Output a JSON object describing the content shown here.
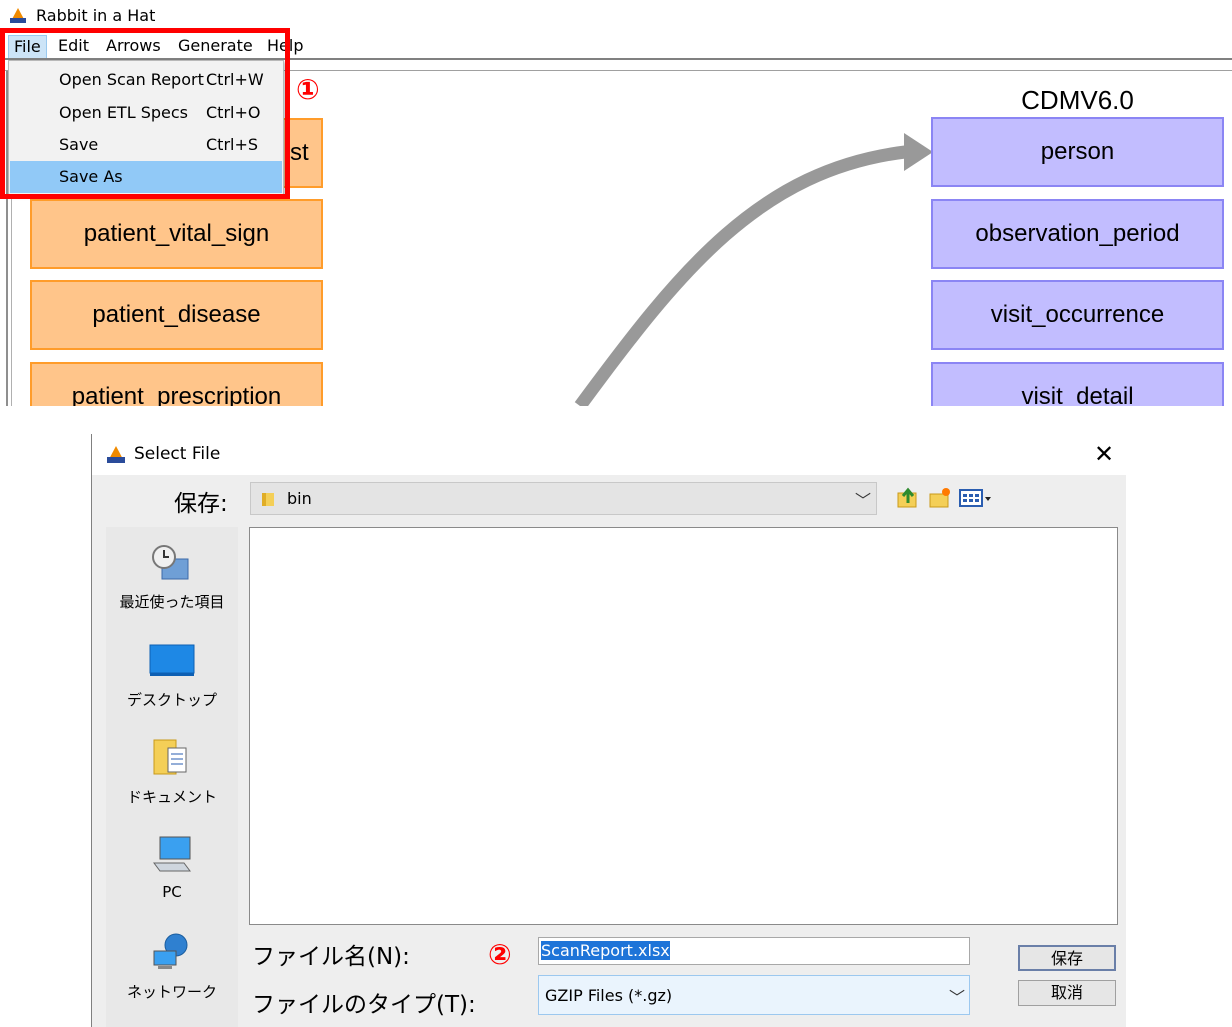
{
  "app": {
    "title": "Rabbit in a Hat",
    "menu": [
      "File",
      "Edit",
      "Arrows",
      "Generate",
      "Help"
    ],
    "file_menu": [
      {
        "label": "Open Scan Report",
        "shortcut": "Ctrl+W"
      },
      {
        "label": "Open ETL Specs",
        "shortcut": "Ctrl+O"
      },
      {
        "label": "Save",
        "shortcut": "Ctrl+S"
      },
      {
        "label": "Save As",
        "shortcut": ""
      }
    ],
    "source_tables": [
      "patient_list",
      "patient_vital_sign",
      "patient_disease",
      "patient_prescription"
    ],
    "source_table_visible_fragment": "st",
    "target_title": "CDMV6.0",
    "target_tables": [
      "person",
      "observation_period",
      "visit_occurrence",
      "visit_detail"
    ],
    "accent": {
      "highlight": "#ff0000",
      "source_fill": "#ffc58a",
      "target_fill": "#c2bdff",
      "arrow": "#999999"
    }
  },
  "markers": {
    "one": "①",
    "two": "②"
  },
  "dialog": {
    "title": "Select File",
    "close": "✕",
    "save_in_label": "保存:",
    "save_in_value": "bin",
    "places": [
      {
        "label": "最近使った項目",
        "icon": "recent-items-icon"
      },
      {
        "label": "デスクトップ",
        "icon": "desktop-icon"
      },
      {
        "label": "ドキュメント",
        "icon": "documents-icon"
      },
      {
        "label": "PC",
        "icon": "computer-icon"
      },
      {
        "label": "ネットワーク",
        "icon": "network-icon"
      }
    ],
    "filename_label": "ファイル名(N):",
    "filename_value": "ScanReport.xlsx",
    "filetype_label": "ファイルのタイプ(T):",
    "filetype_value": "GZIP Files (*.gz)",
    "save_button": "保存",
    "cancel_button": "取消"
  }
}
